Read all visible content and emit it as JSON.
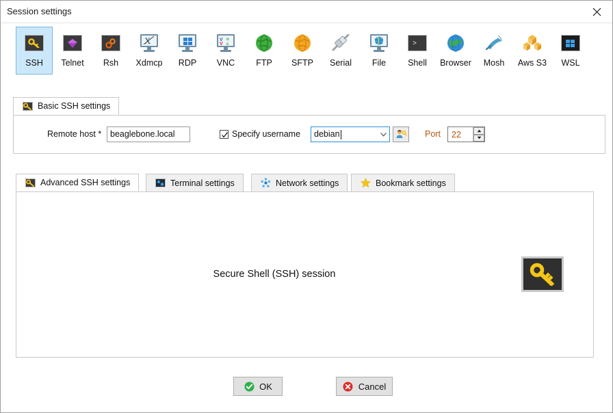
{
  "window": {
    "title": "Session settings",
    "close_icon": "close-icon"
  },
  "session_types": [
    {
      "id": "ssh",
      "label": "SSH",
      "icon": "ssh-key-icon",
      "selected": true
    },
    {
      "id": "telnet",
      "label": "Telnet",
      "icon": "telnet-gem-icon",
      "selected": false
    },
    {
      "id": "rsh",
      "label": "Rsh",
      "icon": "rsh-gears-icon",
      "selected": false
    },
    {
      "id": "xdmcp",
      "label": "Xdmcp",
      "icon": "xdmcp-monitor-icon",
      "selected": false
    },
    {
      "id": "rdp",
      "label": "RDP",
      "icon": "rdp-monitor-icon",
      "selected": false
    },
    {
      "id": "vnc",
      "label": "VNC",
      "icon": "vnc-monitor-icon",
      "selected": false
    },
    {
      "id": "ftp",
      "label": "FTP",
      "icon": "ftp-globe-icon",
      "selected": false
    },
    {
      "id": "sftp",
      "label": "SFTP",
      "icon": "sftp-globe-icon",
      "selected": false
    },
    {
      "id": "serial",
      "label": "Serial",
      "icon": "serial-plug-icon",
      "selected": false
    },
    {
      "id": "file",
      "label": "File",
      "icon": "file-monitor-icon",
      "selected": false
    },
    {
      "id": "shell",
      "label": "Shell",
      "icon": "shell-prompt-icon",
      "selected": false
    },
    {
      "id": "browser",
      "label": "Browser",
      "icon": "browser-globe-icon",
      "selected": false
    },
    {
      "id": "mosh",
      "label": "Mosh",
      "icon": "mosh-dish-icon",
      "selected": false
    },
    {
      "id": "awss3",
      "label": "Aws S3",
      "icon": "aws-s3-cubes-icon",
      "selected": false
    },
    {
      "id": "wsl",
      "label": "WSL",
      "icon": "wsl-windows-icon",
      "selected": false
    }
  ],
  "basic_tab": {
    "label": "Basic SSH settings",
    "icon": "ssh-key-icon"
  },
  "basic_fields": {
    "remote_host_label": "Remote host *",
    "remote_host_value": "beaglebone.local",
    "specify_username_label": "Specify username",
    "specify_username_checked": true,
    "username_value": "debian",
    "username_picker_icon": "user-key-icon",
    "port_label": "Port",
    "port_value": "22",
    "spinner_up_icon": "chevron-up-icon",
    "spinner_down_icon": "chevron-down-icon"
  },
  "lower_tabs": [
    {
      "id": "advanced",
      "label": "Advanced SSH settings",
      "icon": "ssh-key-icon",
      "active": true
    },
    {
      "id": "terminal",
      "label": "Terminal settings",
      "icon": "terminal-icon",
      "active": false
    },
    {
      "id": "network",
      "label": "Network settings",
      "icon": "network-dots-icon",
      "active": false
    },
    {
      "id": "bookmark",
      "label": "Bookmark settings",
      "icon": "star-icon",
      "active": false
    }
  ],
  "content": {
    "description": "Secure Shell (SSH) session",
    "big_icon": "ssh-key-icon"
  },
  "buttons": {
    "ok_label": "OK",
    "ok_icon": "check-circle-icon",
    "cancel_label": "Cancel",
    "cancel_icon": "x-circle-icon"
  },
  "colors": {
    "selected_tab_bg": "#cbe8fa",
    "selected_tab_border": "#7ab8dd",
    "focus_border": "#2a8fd4",
    "port_text": "#b5560b",
    "ok_green": "#2eb14b",
    "cancel_red": "#e02b2b",
    "key_yellow": "#f5c518"
  }
}
